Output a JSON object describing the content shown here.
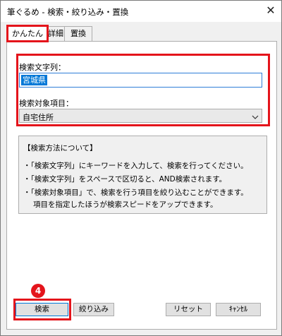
{
  "window": {
    "title": "筆ぐるめ - 検索・絞り込み・置換",
    "close_glyph": "✕"
  },
  "tabs": [
    {
      "label": "かんたん",
      "active": true
    },
    {
      "label": "詳細",
      "active": false
    },
    {
      "label": "置換",
      "active": false
    }
  ],
  "search": {
    "label": "検索文字列：",
    "value": "宮城県"
  },
  "target": {
    "label": "検索対象項目：",
    "selected": "自宅住所",
    "arrow_glyph": "⌄"
  },
  "help": {
    "heading": "【検索方法について】",
    "lines": [
      "・「検索文字列」にキーワードを入力して、検索を行ってください。",
      "・「検索文字列」をスペースで区切ると、AND検索されます。",
      "・「検索対象項目」で、検索を行う項目を絞り込むことができます。",
      "項目を指定したほうが検索スピードをアップできます。"
    ]
  },
  "buttons": {
    "search": "検索",
    "filter": "絞り込み",
    "reset": "リセット",
    "cancel": "ｷｬﾝｾﾙ"
  },
  "step_badge": "4",
  "colors": {
    "highlight_red": "#e4141b",
    "selection_blue": "#0078d7"
  },
  "icons": {
    "close": "close-icon",
    "combo_arrow": "chevron-down-icon"
  }
}
